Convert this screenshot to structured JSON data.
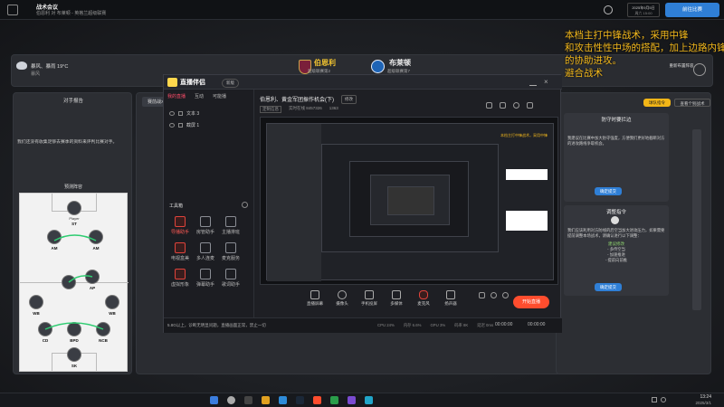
{
  "game": {
    "topbar": {
      "title": "战术会议",
      "subtitle": "伯恩利 对 布莱顿 - 英格兰超级联赛",
      "date_line1": "2025年9月5日",
      "date_line2": "周六 15:00",
      "continue_label": "前往比赛"
    },
    "weather": {
      "text": "暴风、暴雨 19°C",
      "sub": "暴风"
    },
    "home_team": {
      "name": "伯恩利",
      "league": "超级联赛第2"
    },
    "away_team": {
      "name": "布莱顿",
      "league": "超级联赛第7"
    },
    "left_panel": {
      "title": "对手报告",
      "note": "我们还没有收集足够去赛季的资料来评判比赛对手。",
      "formation_title": "预测阵容",
      "positions": [
        "ST",
        "AM",
        "AM",
        "AP",
        "WB",
        "WB",
        "CD",
        "BPD",
        "NCB",
        "SK"
      ]
    },
    "center_tab": "赛前战术",
    "right_panel": {
      "tab_team": "球队指令",
      "tab_individual": "查看个别战术",
      "section1_title": "防守时要拦边",
      "section1_text": "我建议在比赛中加大防守强度，方便我们更好地截断对方的进攻路线争取机会。",
      "confirm_label": "确定提交",
      "section2_title": "调整指令",
      "section2_text": "我们应该利用对方防线的后空当加大进攻压力，如果需要提前调整本场战术，请确认进行以下调整：",
      "changes_title": "建议修改",
      "changes": [
        "- 多传空当",
        "- 加速推进",
        "- 提前向前推"
      ],
      "confirm2_label": "确定提交",
      "side_text": "重新布置阵容"
    },
    "overlay_lines": [
      "本档主打中锋战术，采用中锋",
      "和攻击性性中场的搭配，加上边路内锋",
      "的协助进攻。",
      "避合战术"
    ]
  },
  "stream": {
    "logo": "直播伴侣",
    "version": "新版",
    "tabs": [
      "我的直播",
      "互动",
      "可能播"
    ],
    "scenes": [
      "文本 3",
      "截屏 1"
    ],
    "toolbox_title": "工具箱",
    "tools": [
      {
        "label": "导播助手",
        "icon": "camera-icon"
      },
      {
        "label": "房管助手",
        "icon": "user-icon"
      },
      {
        "label": "主播排班",
        "icon": "calendar-icon"
      },
      {
        "label": "电视盒美",
        "icon": "tv-icon"
      },
      {
        "label": "多人连麦",
        "icon": "people-icon"
      },
      {
        "label": "麦克服务",
        "icon": "mic-icon"
      },
      {
        "label": "虚拟形象",
        "icon": "avatar-icon"
      },
      {
        "label": "弹幕助手",
        "icon": "chat-icon"
      },
      {
        "label": "歌词助手",
        "icon": "music-icon"
      },
      {
        "label": "直播剪辑",
        "icon": "cut-icon"
      }
    ],
    "header_title": "伯恩利、黄金军团振作机会(下)",
    "header_tag": "修改",
    "stream_meta": [
      "定制信息",
      "实时在线 8457326",
      "1363"
    ],
    "status_text": "5.8G以上，诊断无明显问题，直播画面正常，禁止一切",
    "stats": [
      "CPU 24%",
      "内存 6.6%",
      "GPU 3%",
      "码率 8K",
      "延迟 0ms"
    ],
    "bottom_tools": [
      "直播屏幕",
      "摄像头",
      "手机投屏",
      "多媒体",
      "麦克风",
      "扬声器"
    ],
    "record_time": "00:00:00",
    "live_time": "00:00:00",
    "start_label": "开始直播"
  },
  "taskbar": {
    "time": "13:24",
    "date": "2025/3/1"
  }
}
